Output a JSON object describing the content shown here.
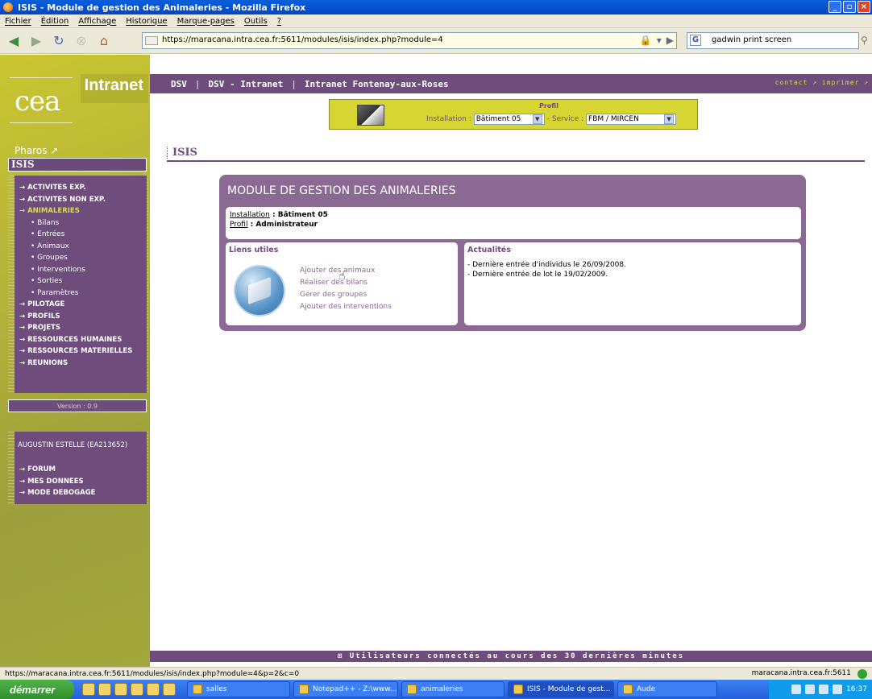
{
  "window": {
    "title": "ISIS - Module de gestion des Animaleries - Mozilla Firefox"
  },
  "menubar": [
    "Fichier",
    "Édition",
    "Affichage",
    "Historique",
    "Marque-pages",
    "Outils",
    "?"
  ],
  "browser": {
    "url": "https://maracana.intra.cea.fr:5611/modules/isis/index.php?module=4",
    "search_value": "gadwin print screen"
  },
  "sidebar": {
    "logo": "cea",
    "intranet": "Intranet",
    "pharos": "Pharos ↗",
    "section": "ISIS",
    "menu": [
      {
        "label": "→ ACTIVITES EXP.",
        "type": "item"
      },
      {
        "label": "→ ACTIVITES NON EXP.",
        "type": "item"
      },
      {
        "label": "→ ANIMALERIES",
        "type": "active"
      },
      {
        "label": "• Bilans",
        "type": "sub"
      },
      {
        "label": "• Entrées",
        "type": "sub"
      },
      {
        "label": "• Animaux",
        "type": "sub"
      },
      {
        "label": "• Groupes",
        "type": "sub"
      },
      {
        "label": "• Interventions",
        "type": "sub"
      },
      {
        "label": "• Sorties",
        "type": "sub"
      },
      {
        "label": "• Paramètres",
        "type": "sub"
      },
      {
        "label": "→ PILOTAGE",
        "type": "item"
      },
      {
        "label": "→ PROFILS",
        "type": "item"
      },
      {
        "label": "→ PROJETS",
        "type": "item"
      },
      {
        "label": "→ RESSOURCES HUMAINES",
        "type": "item"
      },
      {
        "label": "→ RESSOURCES MATERIELLES",
        "type": "item"
      },
      {
        "label": "→ REUNIONS",
        "type": "item"
      }
    ],
    "version": "Version : 0.9",
    "user": "AUGUSTIN ESTELLE (EA213652)",
    "user_menu": [
      "→ FORUM",
      "→ MES DONNEES",
      "→ MODE DEBOGAGE"
    ]
  },
  "topbar": {
    "links": [
      "DSV",
      "DSV - Intranet",
      "Intranet Fontenay-aux-Roses"
    ],
    "right": "contact ↗ imprimer ↗"
  },
  "profil": {
    "title": "Profil",
    "installation_label": "Installation :",
    "installation_value": "Bâtiment 05",
    "service_label": "- Service :",
    "service_value": "FBM / MIRCEN"
  },
  "page": {
    "title": "ISIS",
    "module_title": "MODULE DE GESTION DES ANIMALERIES",
    "installation_label": "Installation",
    "installation_value": " : Bâtiment 05",
    "profil_label": "Profil",
    "profil_value": " : Administrateur",
    "liens_title": "Liens utiles",
    "liens": [
      "Ajouter des animaux",
      "Réaliser des bilans",
      "Gérer des groupes",
      "Ajouter des interventions"
    ],
    "actu_title": "Actualités",
    "actus": [
      "- Dernière entrée d'individus le 26/09/2008.",
      "- Dernière entrée de lot le 19/02/2009."
    ],
    "footer": "⊞ Utilisateurs connectés au cours des 30 dernières minutes"
  },
  "statusbar": {
    "url": "https://maracana.intra.cea.fr:5611/modules/isis/index.php?module=4&p=2&c=0",
    "right": "maracana.intra.cea.fr:5611"
  },
  "taskbar": {
    "start": "démarrer",
    "tasks": [
      "salles",
      "Notepad++ - Z:\\www...",
      "animaleries",
      "ISIS - Module de gest...",
      "Aude"
    ],
    "time": "16:37"
  }
}
